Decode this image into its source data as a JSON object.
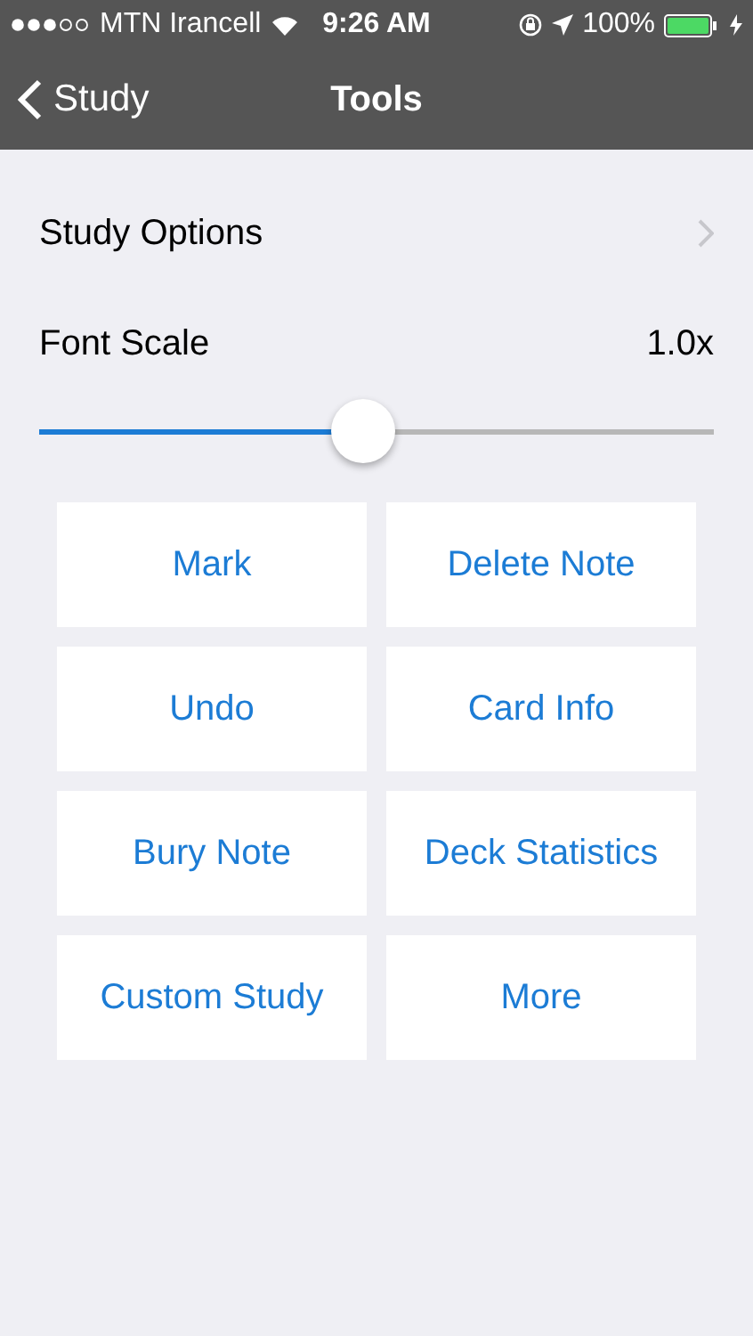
{
  "status_bar": {
    "carrier": "MTN Irancell",
    "time": "9:26 AM",
    "battery": "100%"
  },
  "nav_bar": {
    "back": "Study",
    "title": "Tools"
  },
  "study_options": {
    "label": "Study Options"
  },
  "font_scale": {
    "label": "Font Scale",
    "reading": "1.0x",
    "level": 0.48
  },
  "buttons": [
    "Mark",
    "Delete Note",
    "Undo",
    "Card Info",
    "Bury Note",
    "Deck Statistics",
    "Custom Study",
    "More"
  ]
}
